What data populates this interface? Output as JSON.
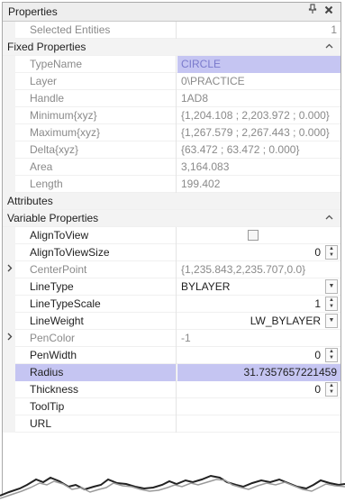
{
  "panel": {
    "title": "Properties",
    "pin_glyph": "ᵖ",
    "close_glyph": "✕"
  },
  "rows": {
    "selected_entities": {
      "name": "Selected Entities",
      "value": "1"
    },
    "fixed_properties": {
      "label": "Fixed Properties"
    },
    "typename": {
      "name": "TypeName",
      "value": "CIRCLE"
    },
    "layer": {
      "name": "Layer",
      "value": "0\\PRACTICE"
    },
    "handle": {
      "name": "Handle",
      "value": "1AD8"
    },
    "minimum": {
      "name": "Minimum{xyz}",
      "value": "{1,204.108 ; 2,203.972 ; 0.000}"
    },
    "maximum": {
      "name": "Maximum{xyz}",
      "value": "{1,267.579 ; 2,267.443 ; 0.000}"
    },
    "delta": {
      "name": "Delta{xyz}",
      "value": "{63.472 ; 63.472 ; 0.000}"
    },
    "area": {
      "name": "Area",
      "value": "3,164.083"
    },
    "length": {
      "name": "Length",
      "value": "199.402"
    },
    "attributes": {
      "label": "Attributes"
    },
    "variable_properties": {
      "label": "Variable Properties"
    },
    "aligntoview": {
      "name": "AlignToView",
      "checked": false
    },
    "aligntoviewsize": {
      "name": "AlignToViewSize",
      "value": "0"
    },
    "centerpoint": {
      "name": "CenterPoint",
      "value": "{1,235.843,2,235.707,0.0}"
    },
    "linetype": {
      "name": "LineType",
      "value": "BYLAYER"
    },
    "linetypescale": {
      "name": "LineTypeScale",
      "value": "1"
    },
    "lineweight": {
      "name": "LineWeight",
      "value": "LW_BYLAYER"
    },
    "pencolor": {
      "name": "PenColor",
      "value": "-1"
    },
    "penwidth": {
      "name": "PenWidth",
      "value": "0"
    },
    "radius": {
      "name": "Radius",
      "value": "31.7357657221459"
    },
    "thickness": {
      "name": "Thickness",
      "value": "0"
    },
    "tooltip": {
      "name": "ToolTip",
      "value": ""
    },
    "url": {
      "name": "URL",
      "value": ""
    }
  },
  "glyphs": {
    "collapse": "^",
    "expand": ">",
    "spin_up": "▲",
    "spin_down": "▼",
    "drop": "▼"
  },
  "colors": {
    "selection": "#c5c5f2",
    "category_bg": "#f3f3f3",
    "readonly_text": "#8a8a8a"
  }
}
